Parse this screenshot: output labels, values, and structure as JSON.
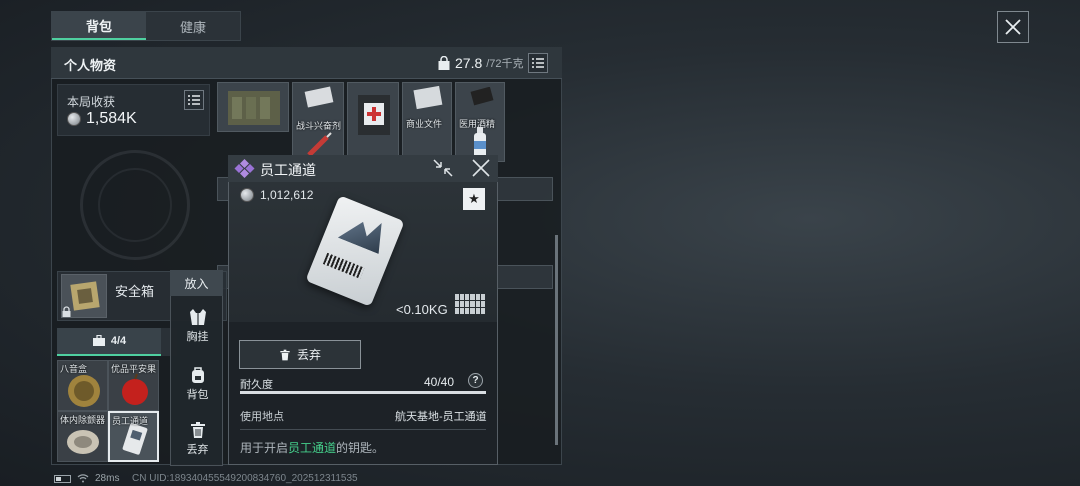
{
  "tabs": [
    {
      "label": "背包",
      "active": true
    },
    {
      "label": "健康",
      "active": false
    }
  ],
  "panel": {
    "title": "个人物资",
    "weight_current": "27.8",
    "weight_max": "/72千克"
  },
  "loot": {
    "title": "本局收获",
    "value": "1,584K"
  },
  "top_items": [
    {
      "label": ""
    },
    {
      "label": "战斗兴奋剂"
    },
    {
      "label": ""
    },
    {
      "label": "商业文件"
    },
    {
      "label": "医用酒精"
    }
  ],
  "safe_box": {
    "label": "安全箱"
  },
  "container_tab": {
    "label": "4/4"
  },
  "pocket_items": [
    {
      "label": "八音盒"
    },
    {
      "label": "优品平安果"
    },
    {
      "label": "体内除颤器"
    },
    {
      "label": "员工通道"
    }
  ],
  "menu": {
    "header": "放入",
    "items": [
      {
        "label": "胸挂",
        "icon": "vest-icon"
      },
      {
        "label": "背包",
        "icon": "backpack-icon"
      },
      {
        "label": "丢弃",
        "icon": "trash-icon"
      }
    ]
  },
  "detail": {
    "title": "员工通道",
    "price": "1,012,612",
    "weight": "<0.10KG",
    "discard_label": "丢弃",
    "durability_label": "耐久度",
    "durability_value": "40/40",
    "durability_fraction": 1.0,
    "help_label": "?",
    "location_label": "使用地点",
    "location_value": "航天基地-员工通道",
    "desc_prefix": "用于开启",
    "desc_highlight": "员工通道",
    "desc_suffix": "的钥匙。"
  },
  "status": {
    "ping": "28ms",
    "uid": "CN UID:18934045554920083476​0_202512311535"
  },
  "colors": {
    "accent_green": "#4fd0a0",
    "highlight_text": "#45d08b"
  }
}
